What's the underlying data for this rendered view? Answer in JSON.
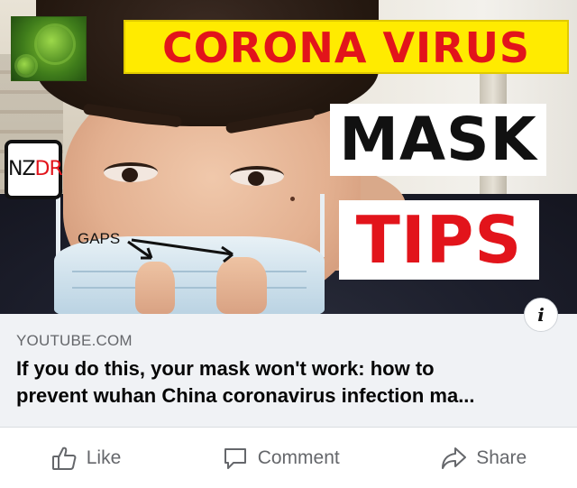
{
  "thumbnail": {
    "banner_text": "CORONA VIRUS",
    "logo_text_left": "NZ",
    "logo_text_right": "DR",
    "word_mask": "MASK",
    "word_tips": "TIPS",
    "gaps_label": "GAPS",
    "info_glyph": "i",
    "colors": {
      "banner_bg": "#ffeb00",
      "accent_red": "#e2141b"
    }
  },
  "link": {
    "domain": "YOUTUBE.COM",
    "title_line1": "If you do this, your mask won't work: how to",
    "title_line2": "prevent wuhan China coronavirus infection ma..."
  },
  "actions": {
    "like_label": "Like",
    "comment_label": "Comment",
    "share_label": "Share",
    "icons": [
      "thumbs-up-icon",
      "comment-bubble-icon",
      "share-arrow-icon"
    ]
  }
}
